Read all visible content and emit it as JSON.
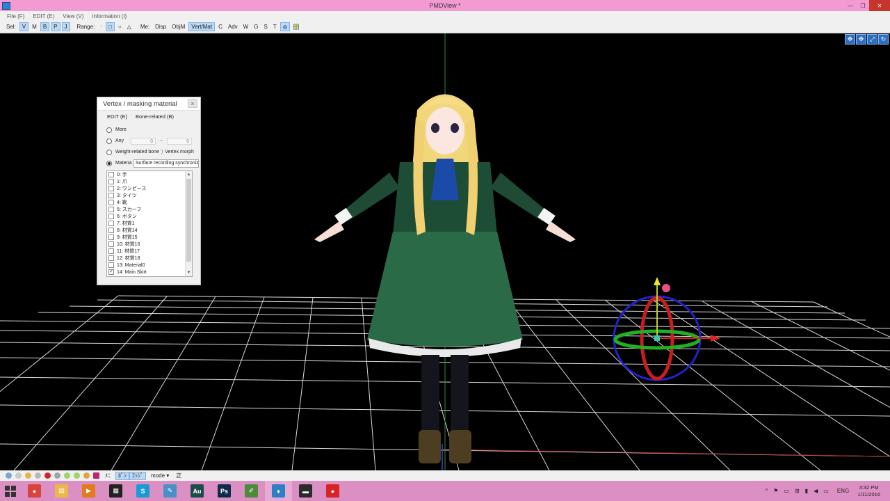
{
  "window": {
    "title": "PMDView *",
    "minimize": "—",
    "restore": "❐",
    "close": "✕"
  },
  "menu": [
    "File (F)",
    "EDIT (E)",
    "View (V)",
    "Information (I)"
  ],
  "toolbar": {
    "sel_label": "Sel:",
    "sel_items": [
      "V",
      "M",
      "B",
      "P",
      "J"
    ],
    "range_label": "Range:",
    "range_items": [
      "·",
      "□",
      "○",
      "△"
    ],
    "me_label": "Me:",
    "me_items": [
      "Disp",
      "ObjM",
      "Vert/Mat",
      "C",
      "Adv",
      "W",
      "G",
      "S",
      "T"
    ]
  },
  "panel": {
    "title": "Vertex / masking material",
    "close": "×",
    "menu": [
      "EDIT (E)",
      "Bone-related (B)"
    ],
    "radio_more": "More",
    "radio_any": "Any",
    "any_from": "0",
    "any_tilde": "~",
    "any_to": "0",
    "radio_weight": "Weight-related bone",
    "radio_vertex_morph": "Vertex morph",
    "radio_material": "Materia",
    "material_field": "Surface recording synchroniz",
    "materials": [
      {
        "label": "0: 手",
        "checked": false
      },
      {
        "label": "1: 爪",
        "checked": false
      },
      {
        "label": "2: ワンピース",
        "checked": false
      },
      {
        "label": "3: タイツ",
        "checked": false
      },
      {
        "label": "4: 靴",
        "checked": false
      },
      {
        "label": "5: スカーフ",
        "checked": false
      },
      {
        "label": "6: ボタン",
        "checked": false
      },
      {
        "label": "7: 材質1",
        "checked": false
      },
      {
        "label": "8: 材質14",
        "checked": false
      },
      {
        "label": "9: 材質15",
        "checked": false
      },
      {
        "label": "10: 材質16",
        "checked": false
      },
      {
        "label": "11: 材質17",
        "checked": false
      },
      {
        "label": "12: 材質18",
        "checked": false
      },
      {
        "label": "13: Material0",
        "checked": false
      },
      {
        "label": "14: Main Skirt",
        "checked": true
      }
    ]
  },
  "bottombar": {
    "items": [
      "ﾒﾆ",
      "ﾎﾞﾝ",
      "ｴｯｼﾞ",
      "mode ▾",
      "正"
    ]
  },
  "taskbar": {
    "apps": [
      {
        "name": "chrome",
        "glyph": "●",
        "color": "#d8433a"
      },
      {
        "name": "file-explorer",
        "glyph": "▤",
        "color": "#e9b84a"
      },
      {
        "name": "media-player",
        "glyph": "▶",
        "color": "#e27a1e"
      },
      {
        "name": "film-app",
        "glyph": "▦",
        "color": "#222222"
      },
      {
        "name": "skype",
        "glyph": "S",
        "color": "#1a9ad6"
      },
      {
        "name": "notes-app",
        "glyph": "✎",
        "color": "#4a90c8"
      },
      {
        "name": "audition",
        "glyph": "Au",
        "color": "#1c4c4a"
      },
      {
        "name": "photoshop",
        "glyph": "Ps",
        "color": "#0e2b4b"
      },
      {
        "name": "editor-app",
        "glyph": "✐",
        "color": "#4d8a3a"
      },
      {
        "name": "pmd-editor",
        "glyph": "♦",
        "color": "#2e7fc6"
      },
      {
        "name": "flag-app",
        "glyph": "▬",
        "color": "#2a2a2a"
      },
      {
        "name": "record-app",
        "glyph": "●",
        "color": "#d82424"
      }
    ],
    "tray": {
      "chevron": "^",
      "lang": "ENG",
      "time": "3:32 PM",
      "date": "1/11/2016"
    }
  },
  "colors": {
    "titlebar": "#f49ad3",
    "taskbar": "#dc8fc3",
    "grid": "#d9d9d9",
    "viewport": "#000000"
  }
}
